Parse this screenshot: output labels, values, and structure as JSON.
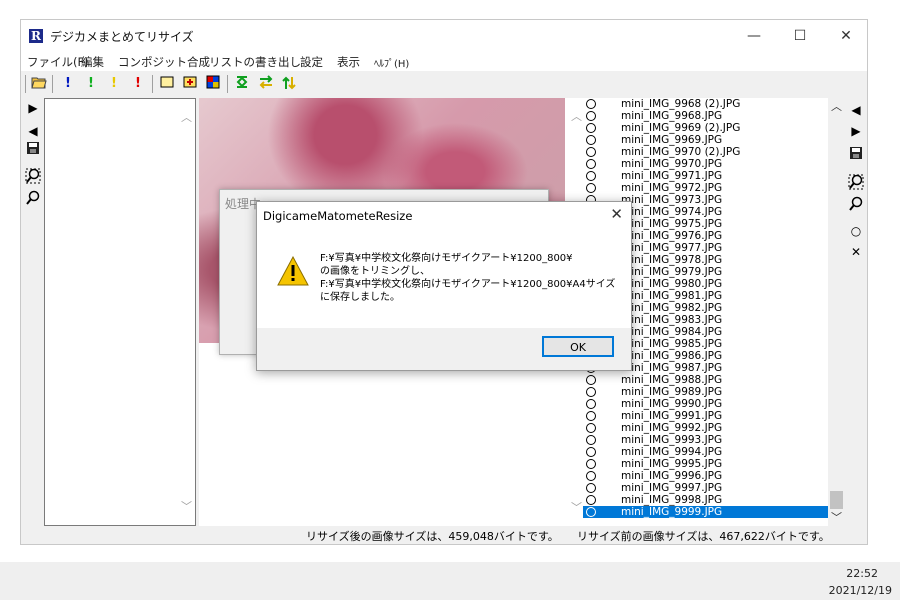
{
  "window": {
    "title": "デジカメまとめてリサイズ",
    "icon_letter": "R"
  },
  "window_buttons": {
    "minimize": "—",
    "maximize": "☐",
    "close": "✕"
  },
  "menu": [
    "ファイル(F)",
    "編集",
    "コンポジット合成",
    "リストの書き出し",
    "設定",
    "表示",
    "ﾍﾙﾌﾟ(H)"
  ],
  "toolbar_icons": [
    "open-folder-icon",
    "exclaim-blue-icon",
    "exclaim-green-icon",
    "exclaim-yellow-icon",
    "exclaim-red-icon",
    "crop-frame-icon",
    "crop-plus-icon",
    "grid-color-icon",
    "merge-icon",
    "swap-horizontal-icon",
    "swap-vertical-icon"
  ],
  "processing_dialog": {
    "title": "処理中"
  },
  "message_dialog": {
    "title": "DigicameMatometeResize",
    "lines": [
      "F:¥写真¥中学校文化祭向けモザイクアート¥1200_800¥",
      "の画像をトリミングし、",
      "F:¥写真¥中学校文化祭向けモザイクアート¥1200_800¥A4サイズ",
      "に保存しました。"
    ],
    "ok_label": "OK"
  },
  "files": [
    "mini_IMG_9968 (2).JPG",
    "mini_IMG_9968.JPG",
    "mini_IMG_9969 (2).JPG",
    "mini_IMG_9969.JPG",
    "mini_IMG_9970 (2).JPG",
    "mini_IMG_9970.JPG",
    "mini_IMG_9971.JPG",
    "mini_IMG_9972.JPG",
    "mini_IMG_9973.JPG",
    "mini_IMG_9974.JPG",
    "mini_IMG_9975.JPG",
    "mini_IMG_9976.JPG",
    "mini_IMG_9977.JPG",
    "mini_IMG_9978.JPG",
    "mini_IMG_9979.JPG",
    "mini_IMG_9980.JPG",
    "mini_IMG_9981.JPG",
    "mini_IMG_9982.JPG",
    "mini_IMG_9983.JPG",
    "mini_IMG_9984.JPG",
    "mini_IMG_9985.JPG",
    "mini_IMG_9986.JPG",
    "mini_IMG_9987.JPG",
    "mini_IMG_9988.JPG",
    "mini_IMG_9989.JPG",
    "mini_IMG_9990.JPG",
    "mini_IMG_9991.JPG",
    "mini_IMG_9992.JPG",
    "mini_IMG_9993.JPG",
    "mini_IMG_9994.JPG",
    "mini_IMG_9995.JPG",
    "mini_IMG_9996.JPG",
    "mini_IMG_9997.JPG",
    "mini_IMG_9998.JPG",
    "mini_IMG_9999.JPG"
  ],
  "selected_file": "mini_IMG_9999.JPG",
  "status": {
    "after": "リサイズ後の画像サイズは、459,048バイトです。",
    "before": "リサイズ前の画像サイズは、467,622バイトです。"
  },
  "taskbar": {
    "time": "22:52",
    "date": "2021/12/19"
  },
  "colors": {
    "selection": "#0078d7",
    "app_icon": "#1c2a8a"
  }
}
